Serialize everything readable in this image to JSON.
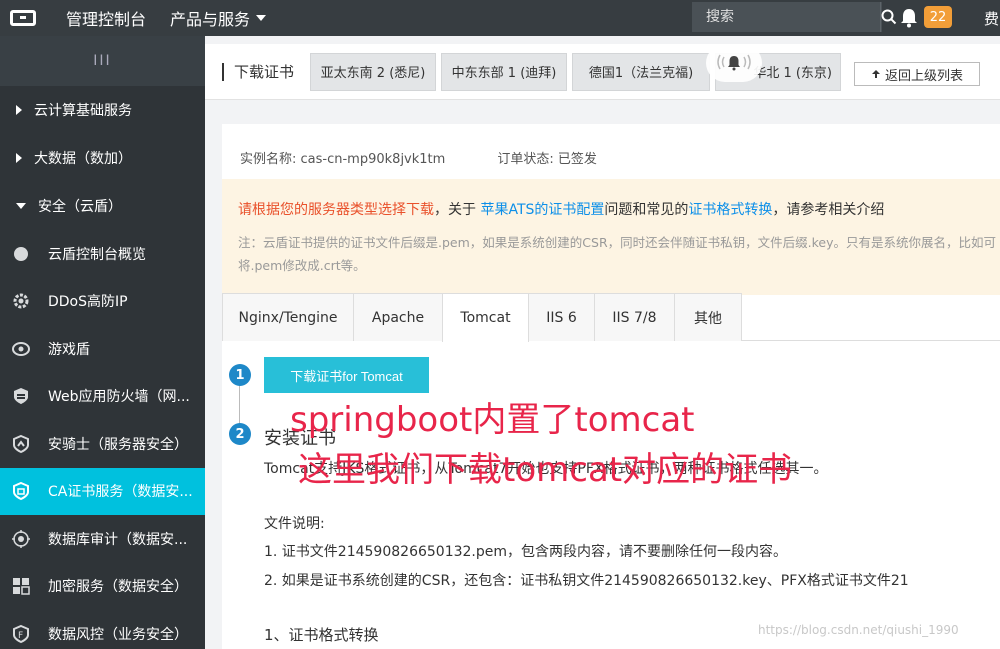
{
  "topbar": {
    "console": "管理控制台",
    "products": "产品与服务",
    "search_placeholder": "搜索",
    "badge_count": "22",
    "fee": "费"
  },
  "sidebar": {
    "collapse": "III",
    "groups": [
      {
        "label": "云计算基础服务",
        "expanded": false
      },
      {
        "label": "大数据（数加）",
        "expanded": false
      },
      {
        "label": "安全（云盾）",
        "expanded": true
      }
    ],
    "items": [
      {
        "label": "云盾控制台概览",
        "icon": "overview-icon"
      },
      {
        "label": "DDoS高防IP",
        "icon": "gear-icon"
      },
      {
        "label": "游戏盾",
        "icon": "game-shield-icon"
      },
      {
        "label": "Web应用防火墙（网...",
        "icon": "firewall-icon"
      },
      {
        "label": "安骑士（服务器安全）",
        "icon": "shield-icon"
      },
      {
        "label": "CA证书服务（数据安...",
        "icon": "certificate-icon",
        "active": true
      },
      {
        "label": "数据库审计（数据安...",
        "icon": "database-audit-icon"
      },
      {
        "label": "加密服务（数据安全）",
        "icon": "encryption-icon"
      },
      {
        "label": "数据风控（业务安全）",
        "icon": "risk-control-icon"
      }
    ]
  },
  "header": {
    "title": "下载证书",
    "regions": [
      "亚太东南 2 (悉尼)",
      "中东东部 1 (迪拜)",
      "德国1（法兰克福)",
      "华北 1 (东京)"
    ],
    "back": "返回上级列表"
  },
  "instance": {
    "name_label": "实例名称:",
    "name_value": "cas-cn-mp90k8jvk1tm",
    "status_label": "订单状态:",
    "status_value": "已签发"
  },
  "notice": {
    "warn": "请根据您的服务器类型选择下载",
    "text1": "，关于",
    "link1": "苹果ATS的证书配置",
    "text2": "问题和常见的",
    "link2": "证书格式转换",
    "text3": "，请参考相关介绍",
    "sub": "注：云盾证书提供的证书文件后缀是.pem，如果是系统创建的CSR，同时还会伴随证书私钥，文件后缀.key。只有是系统你展名，比如可将.pem修改成.crt等。"
  },
  "tabs": [
    "Nginx/Tengine",
    "Apache",
    "Tomcat",
    "IIS 6",
    "IIS 7/8",
    "其他"
  ],
  "active_tab": "Tomcat",
  "steps": {
    "step1_num": "1",
    "download_btn": "下载证书for Tomcat",
    "step2_num": "2",
    "step2_title": "安装证书",
    "intro": "Tomcat支持JKS格式证书，从Tomcat7开始也支持PFX格式证书，两种证书格式任选其一。",
    "files_label": "文件说明:",
    "file1": "1. 证书文件214590826650132.pem，包含两段内容，请不要删除任何一段内容。",
    "file2": "2. 如果是证书系统创建的CSR，还包含：证书私钥文件214590826650132.key、PFX格式证书文件21",
    "convert": "1、证书格式转换"
  },
  "annotation": {
    "line1": "springboot内置了tomcat",
    "line2": "这里我们下载tomcat对应的证书"
  },
  "watermark": "https://blog.csdn.net/qiushi_1990",
  "colors": {
    "topbar": "#373d41",
    "sidebar": "#2f3438",
    "active": "#00c1de",
    "button": "#28bfd8",
    "annotation": "#e8254a",
    "badge": "#f29e38"
  }
}
